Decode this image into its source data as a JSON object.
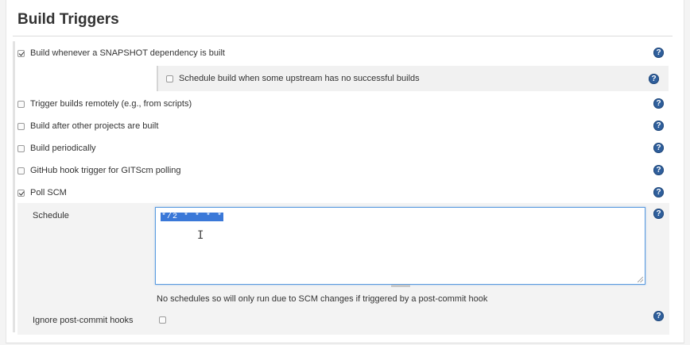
{
  "section": {
    "title": "Build Triggers"
  },
  "triggers": [
    {
      "label": "Build whenever a SNAPSHOT dependency is built",
      "checked": true
    },
    {
      "label": "Trigger builds remotely (e.g., from scripts)",
      "checked": false
    },
    {
      "label": "Build after other projects are built",
      "checked": false
    },
    {
      "label": "Build periodically",
      "checked": false
    },
    {
      "label": "GitHub hook trigger for GITScm polling",
      "checked": false
    },
    {
      "label": "Poll SCM",
      "checked": true
    }
  ],
  "snapshot_sub": {
    "label": "Schedule build when some upstream has no successful builds",
    "checked": false
  },
  "poll": {
    "schedule_label": "Schedule",
    "schedule_value": "*/2 * * * *",
    "hint": "No schedules so will only run due to SCM changes if triggered by a post-commit hook",
    "ignore_label": "Ignore post-commit hooks",
    "ignore_checked": false
  },
  "help_glyph": "?",
  "icons": {
    "help": "help-icon",
    "checkbox": "checkbox-icon",
    "text_cursor": "text-cursor-icon"
  },
  "colors": {
    "help_icon": "#2f5f9c",
    "selection": "#3a78d8",
    "focus_border": "#5b9be0"
  }
}
